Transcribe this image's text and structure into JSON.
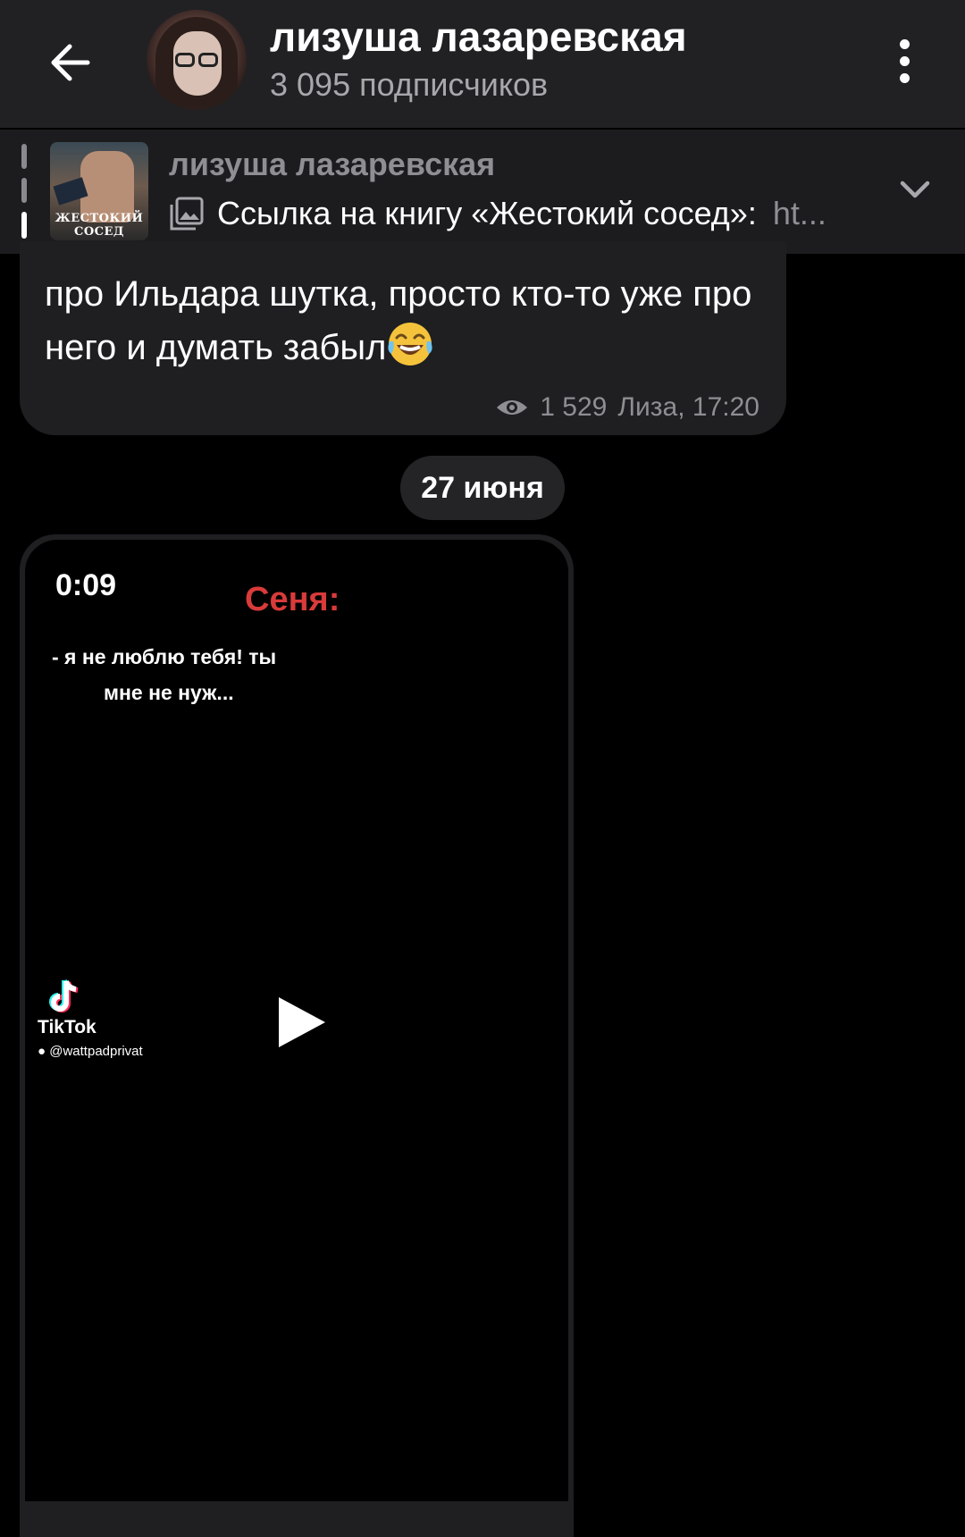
{
  "header": {
    "title": "лизуша лазаревская",
    "subscribers": "3 095 подписчиков"
  },
  "pinned": {
    "author": "лизуша лазаревская",
    "text": "Ссылка на книгу «Жестокий сосед»:",
    "link_preview": "ht...",
    "thumbnail_caption": "ЖЕСТОКИЙ СОСЕД",
    "icon": "image-icon"
  },
  "message": {
    "text": "про Ильдара шутка, просто кто-то уже про него и думать забыл",
    "emoji": "face-with-tears-of-joy",
    "views": "1 529",
    "author_time": "Лиза, 17:20"
  },
  "date_chip": "27 июня",
  "video": {
    "duration": "0:09",
    "speaker": "Сеня:",
    "line1": "- я не люблю тебя! ты",
    "line2": "мне не нуж...",
    "tiktok_label": "TikTok",
    "tiktok_user": "@wattpadprivat"
  },
  "colors": {
    "header_bg": "#212124",
    "bubble_bg": "#1f1f22",
    "muted_text": "#8e8e93",
    "speaker_red": "#d93a3a"
  }
}
